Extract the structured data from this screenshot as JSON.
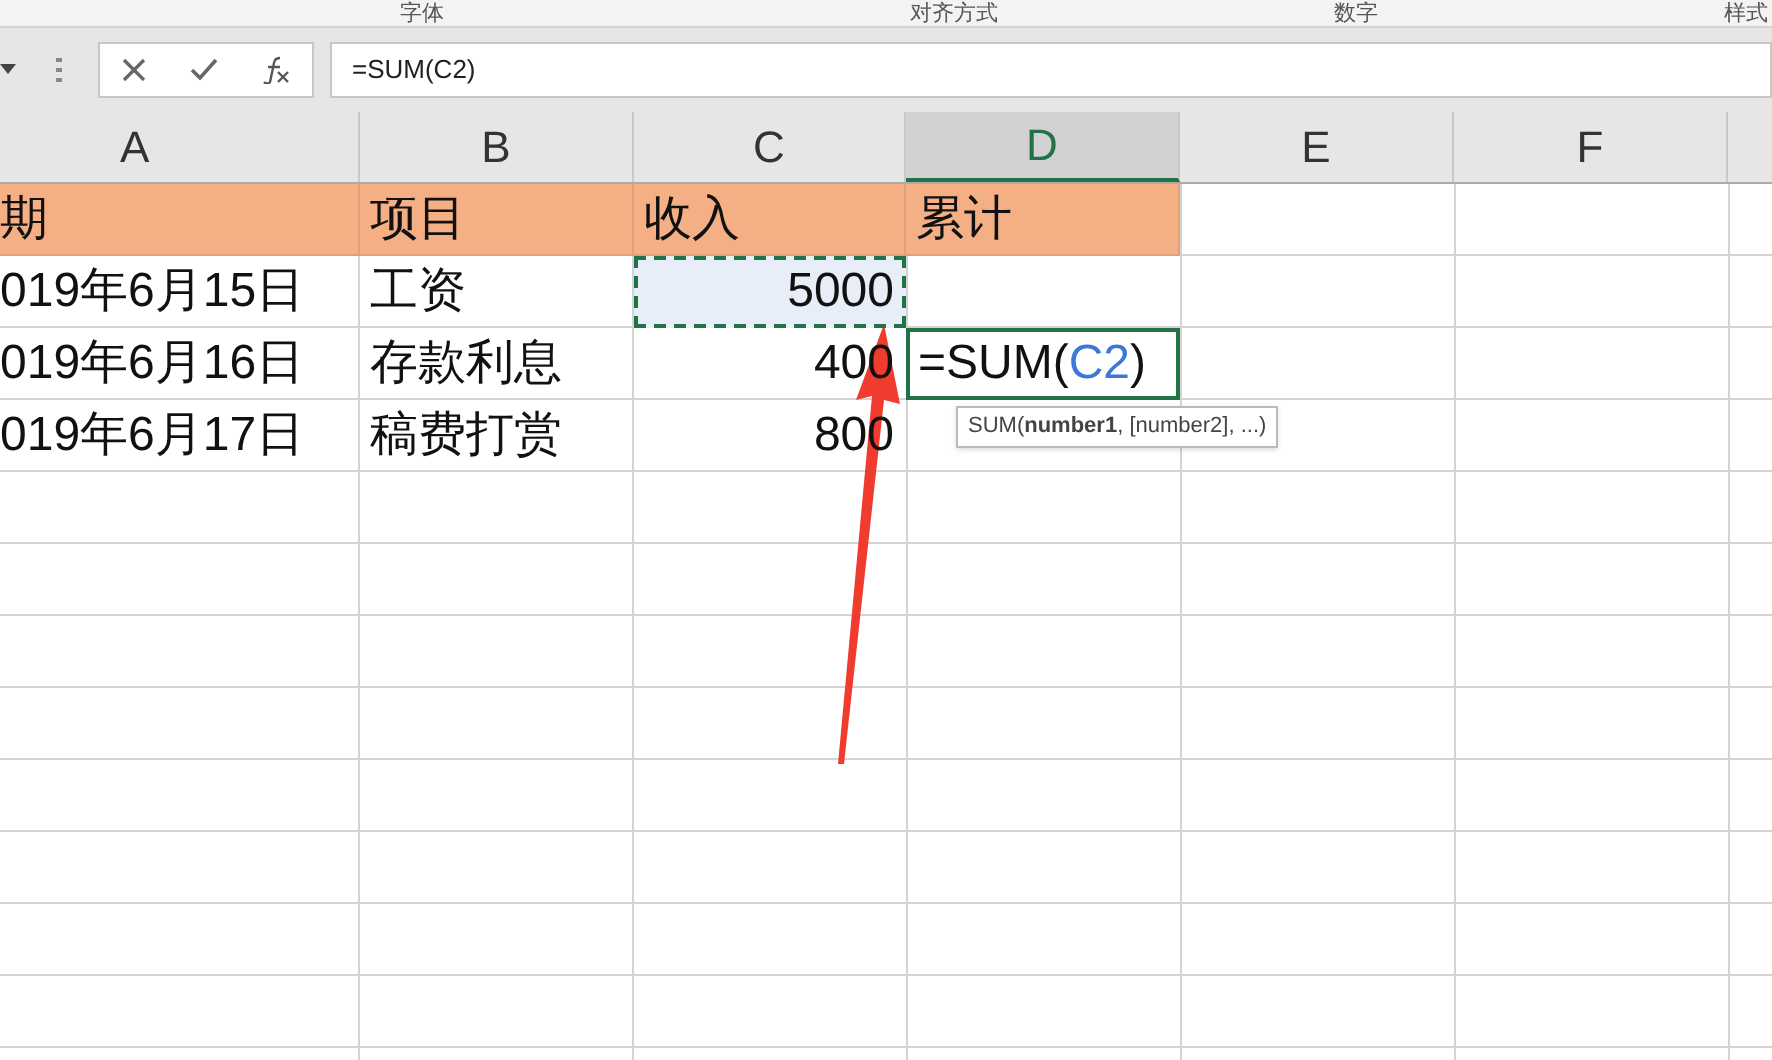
{
  "ribbon_groups": [
    {
      "label": "字体"
    },
    {
      "label": "对齐方式"
    },
    {
      "label": "数字"
    },
    {
      "label": "样式"
    }
  ],
  "formula_bar": {
    "value": "=SUM(C2)"
  },
  "columns": [
    {
      "label": "A",
      "selected": false
    },
    {
      "label": "B",
      "selected": false
    },
    {
      "label": "C",
      "selected": false
    },
    {
      "label": "D",
      "selected": true
    },
    {
      "label": "E",
      "selected": false
    },
    {
      "label": "F",
      "selected": false
    }
  ],
  "rows": [
    {
      "header": true,
      "cells": [
        {
          "kind": "text",
          "text": "期"
        },
        {
          "kind": "text",
          "text": "项目"
        },
        {
          "kind": "text",
          "text": "收入"
        },
        {
          "kind": "text",
          "text": "累计"
        },
        {
          "kind": "empty"
        },
        {
          "kind": "empty"
        }
      ]
    },
    {
      "header": false,
      "cells": [
        {
          "kind": "text",
          "text": "019年6月15日"
        },
        {
          "kind": "text",
          "text": "工资"
        },
        {
          "kind": "number",
          "text": "5000",
          "copied": true
        },
        {
          "kind": "empty"
        },
        {
          "kind": "empty"
        },
        {
          "kind": "empty"
        }
      ]
    },
    {
      "header": false,
      "cells": [
        {
          "kind": "text",
          "text": "019年6月16日"
        },
        {
          "kind": "text",
          "text": "存款利息"
        },
        {
          "kind": "number",
          "text": "400"
        },
        {
          "kind": "formula",
          "editing": true,
          "formula": [
            "=SUM(",
            "C2",
            ")"
          ]
        },
        {
          "kind": "empty"
        },
        {
          "kind": "empty"
        }
      ]
    },
    {
      "header": false,
      "cells": [
        {
          "kind": "text",
          "text": "019年6月17日"
        },
        {
          "kind": "text",
          "text": "稿费打赏"
        },
        {
          "kind": "number",
          "text": "800"
        },
        {
          "kind": "empty"
        },
        {
          "kind": "empty"
        },
        {
          "kind": "empty"
        }
      ]
    }
  ],
  "tooltip": "SUM(**number1**, [number2], ...)"
}
